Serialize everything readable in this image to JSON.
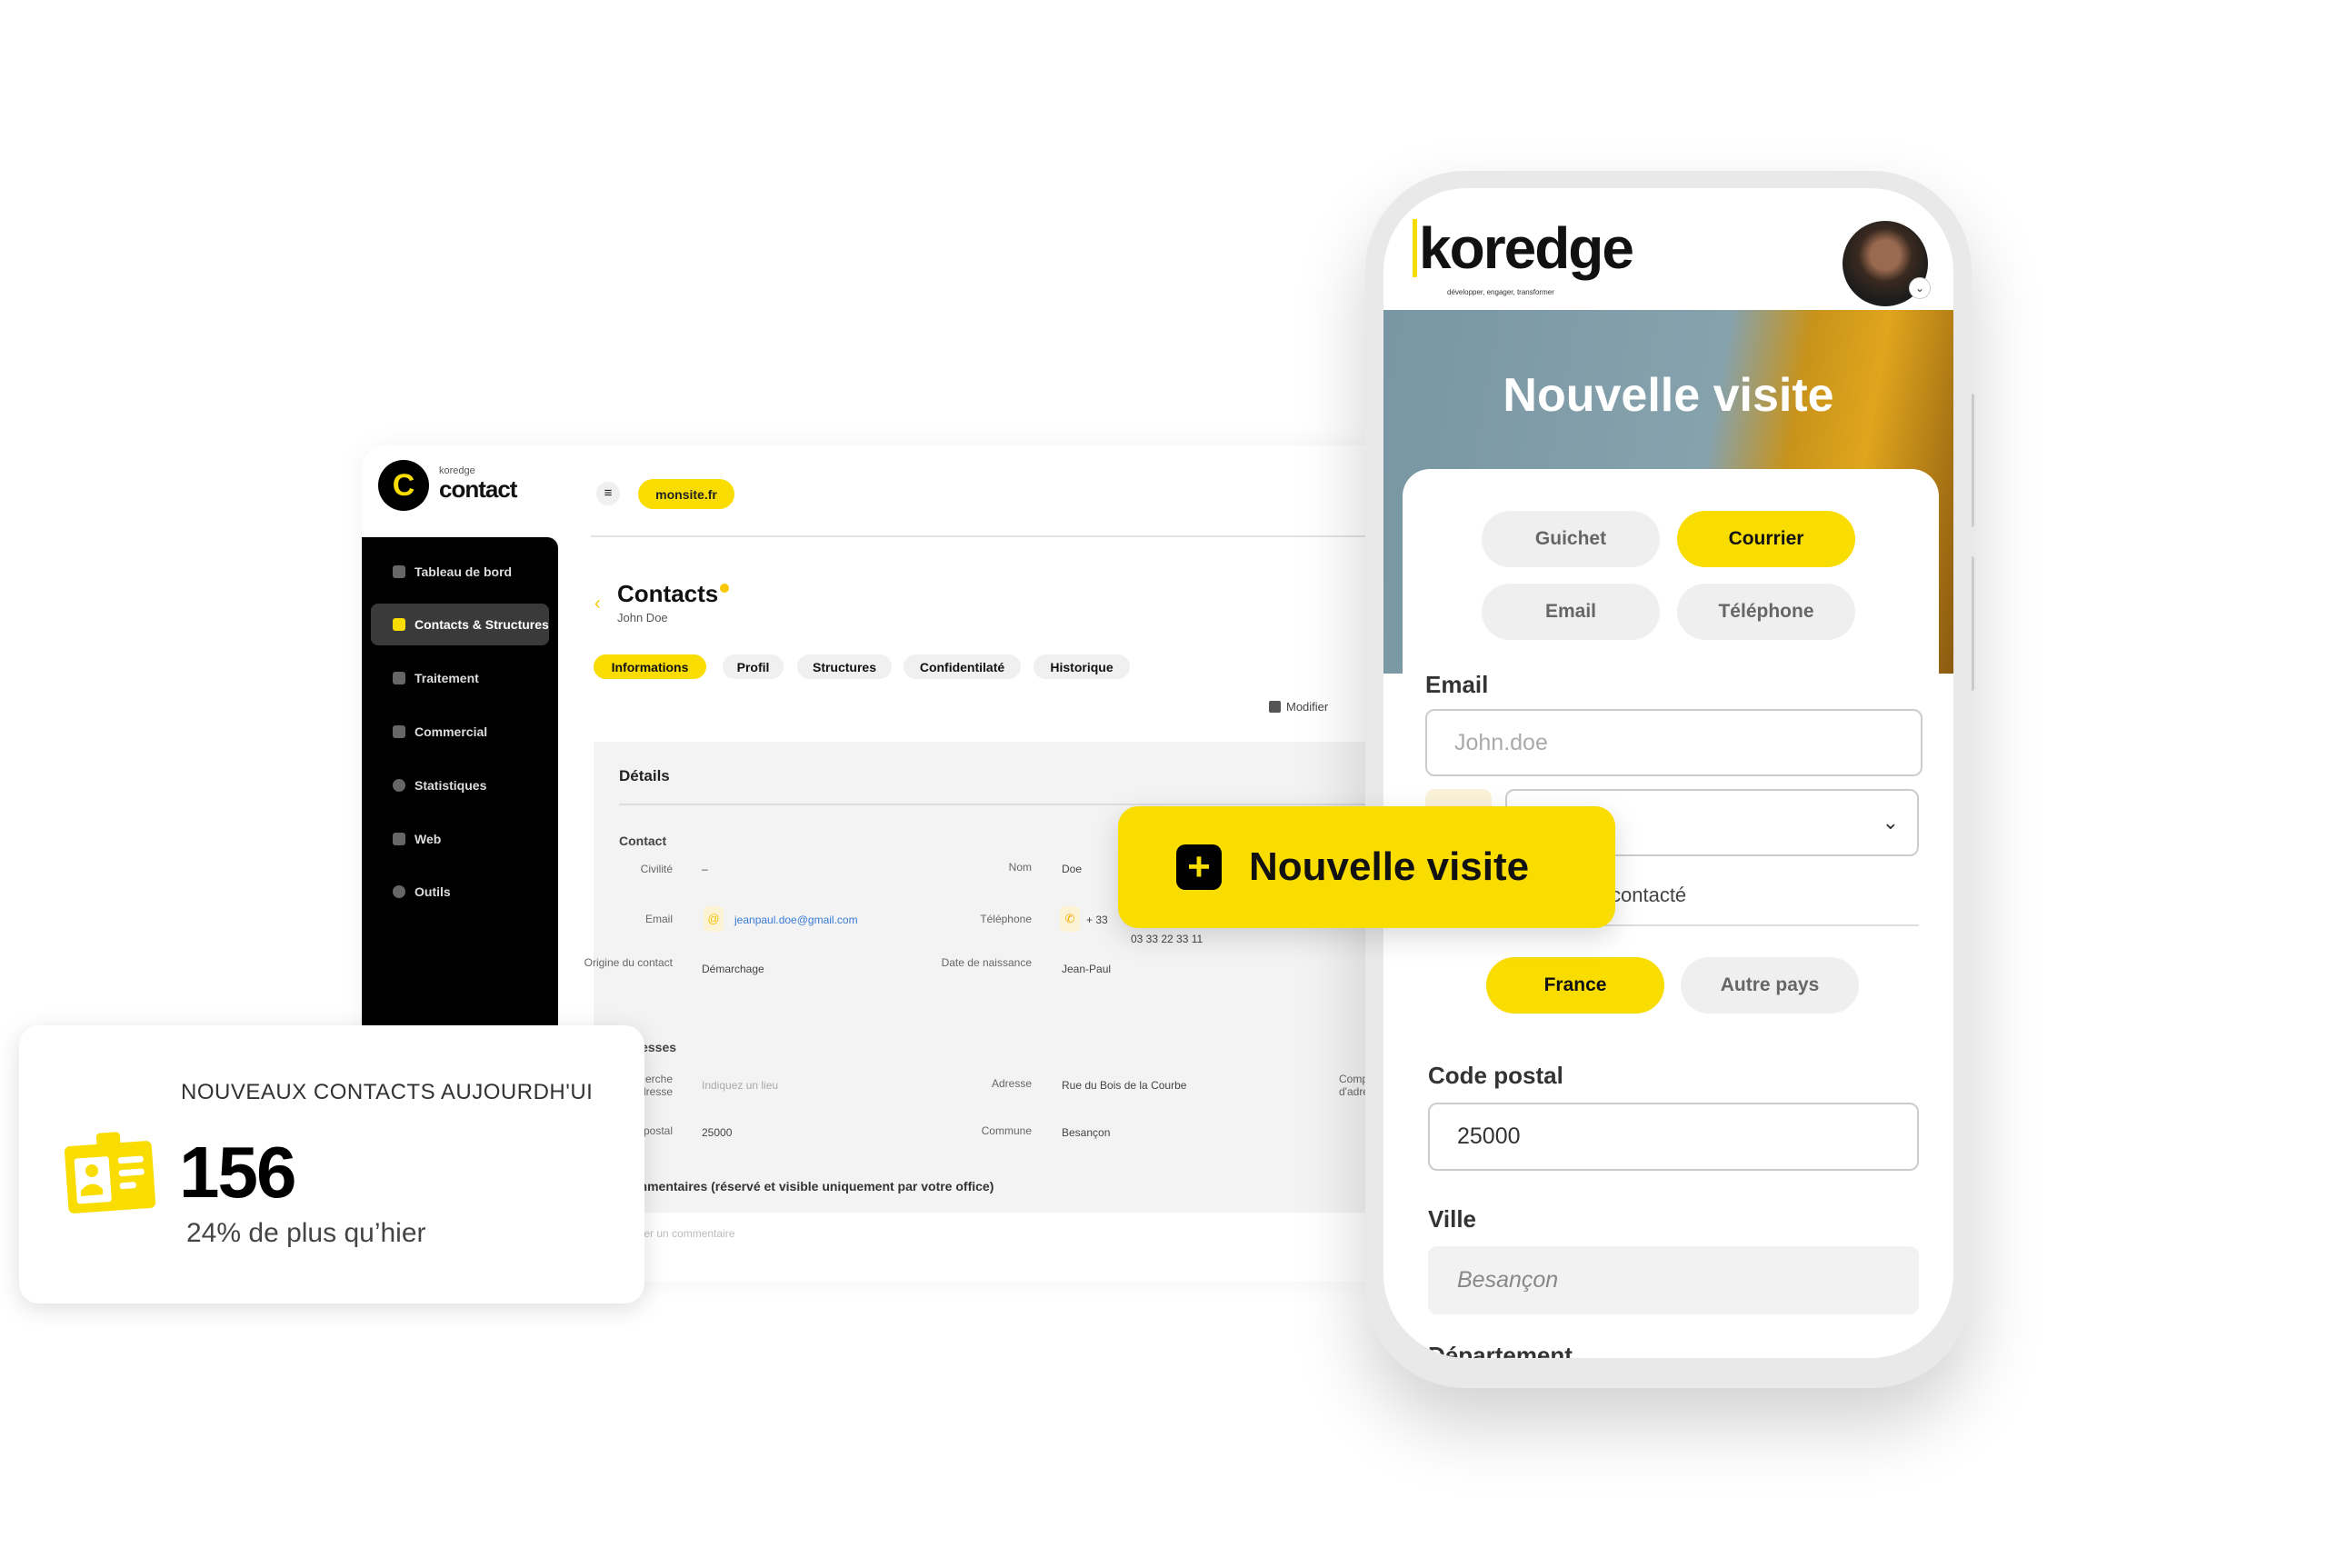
{
  "desktop": {
    "logo": {
      "small": "koredge",
      "main": "contact"
    },
    "site_pill": "monsite.fr",
    "sidebar": [
      {
        "label": "Tableau de bord",
        "icon": "home-icon"
      },
      {
        "label": "Contacts & Structures",
        "icon": "contact-icon",
        "active": true
      },
      {
        "label": "Traitement",
        "icon": "arrows-icon"
      },
      {
        "label": "Commercial",
        "icon": "bank-icon"
      },
      {
        "label": "Statistiques",
        "icon": "pie-chart-icon"
      },
      {
        "label": "Web",
        "icon": "monitor-icon"
      },
      {
        "label": "Outils",
        "icon": "gear-icon"
      }
    ],
    "page_title": "Contacts",
    "subtitle": "John Doe",
    "tabs": [
      "Informations",
      "Profil",
      "Structures",
      "Confidentilaté",
      "Historique"
    ],
    "modify": "Modifier",
    "details_title": "Détails",
    "contact_section": "Contact",
    "fields": {
      "civilite_label": "Civilité",
      "civilite": "–",
      "nom_label": "Nom",
      "nom": "Doe",
      "email_label": "Email",
      "email": "jeanpaul.doe@gmail.com",
      "tel_label": "Téléphone",
      "tel_prefix": "+ 33",
      "tel": "03 33 22 33 11",
      "origine_label": "Origine du contact",
      "origine": "Démarchage",
      "naissance_label": "Date de naissance",
      "naissance": "Jean-Paul"
    },
    "address_section": "Adresses",
    "address": {
      "search_label": "Recherche d'adresse",
      "search_placeholder": "Indiquez un lieu",
      "adresse_label": "Adresse",
      "adresse": "Rue du Bois de la Courbe",
      "complement_label": "Complément d'adresse",
      "cp_label": "Code postal",
      "cp": "25000",
      "commune_label": "Commune",
      "commune": "Besançon"
    },
    "comments_title": "Commentaires (réservé et visible uniquement par votre office)",
    "comments_placeholder": "Ajouter un commentaire"
  },
  "banner": {
    "label": "Nouvelle visite",
    "icon": "plus-icon"
  },
  "phone": {
    "logo": "koredge",
    "tagline": "développer, engager, transformer",
    "hero_title": "Nouvelle visite",
    "channels": [
      {
        "label": "Guichet",
        "selected": false
      },
      {
        "label": "Courrier",
        "selected": true
      },
      {
        "label": "Email",
        "selected": false
      },
      {
        "label": "Téléphone",
        "selected": false
      }
    ],
    "email_label": "Email",
    "email_placeholder": "John.doe",
    "select_value_tail": "n",
    "contacted_tail": "contacté",
    "countries": [
      {
        "label": "France",
        "selected": true
      },
      {
        "label": "Autre pays",
        "selected": false
      }
    ],
    "cp_label": "Code postal",
    "cp_value": "25000",
    "ville_label": "Ville",
    "ville_value": "Besançon",
    "departement_label": "Département"
  },
  "stats": {
    "title": "NOUVEAUX CONTACTS AUJOURDH'UI",
    "value": "156",
    "delta": "24% de plus qu’hier",
    "icon": "id-badge-icon"
  },
  "colors": {
    "accent": "#F9DC00",
    "sidebar": "#000000",
    "link": "#3a7bd5"
  }
}
